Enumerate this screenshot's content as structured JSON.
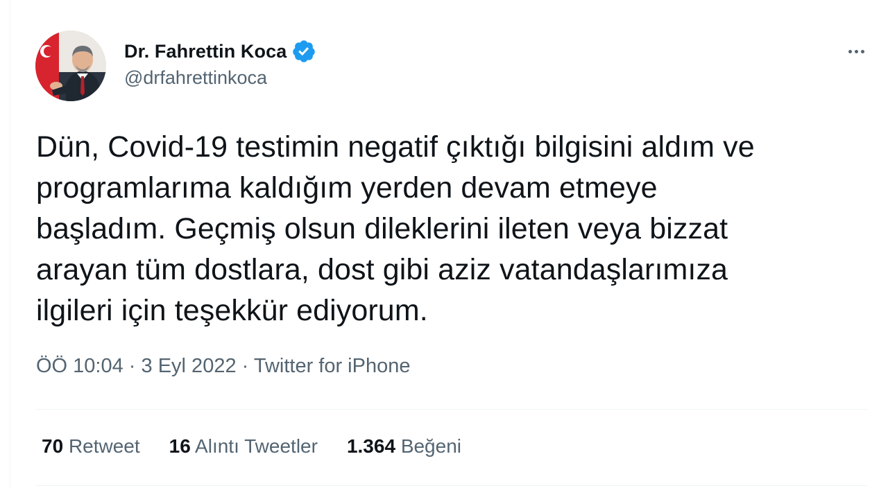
{
  "author": {
    "display_name": "Dr. Fahrettin Koca",
    "handle": "@drfahrettinkoca",
    "verified": true,
    "verified_color": "#1d9bf0"
  },
  "menu": {
    "icon": "more-horizontal-icon"
  },
  "tweet": {
    "text": "Dün, Covid-19 testimin negatif çıktığı bilgisini aldım ve\nprogramlarıma kaldığım yerden devam etmeye\nbaşladım. Geçmiş olsun dileklerini ileten veya bizzat\narayan tüm dostlara, dost gibi aziz vatandaşlarımıza\nilgileri için teşekkür ediyorum."
  },
  "meta": {
    "time": "ÖÖ 10:04",
    "separator": " · ",
    "date": "3 Eyl 2022",
    "source": "Twitter for iPhone"
  },
  "stats": {
    "retweets": {
      "count": "70",
      "label": "Retweet"
    },
    "quotes": {
      "count": "16",
      "label": "Alıntı Tweetler"
    },
    "likes": {
      "count": "1.364",
      "label": "Beğeni"
    }
  }
}
